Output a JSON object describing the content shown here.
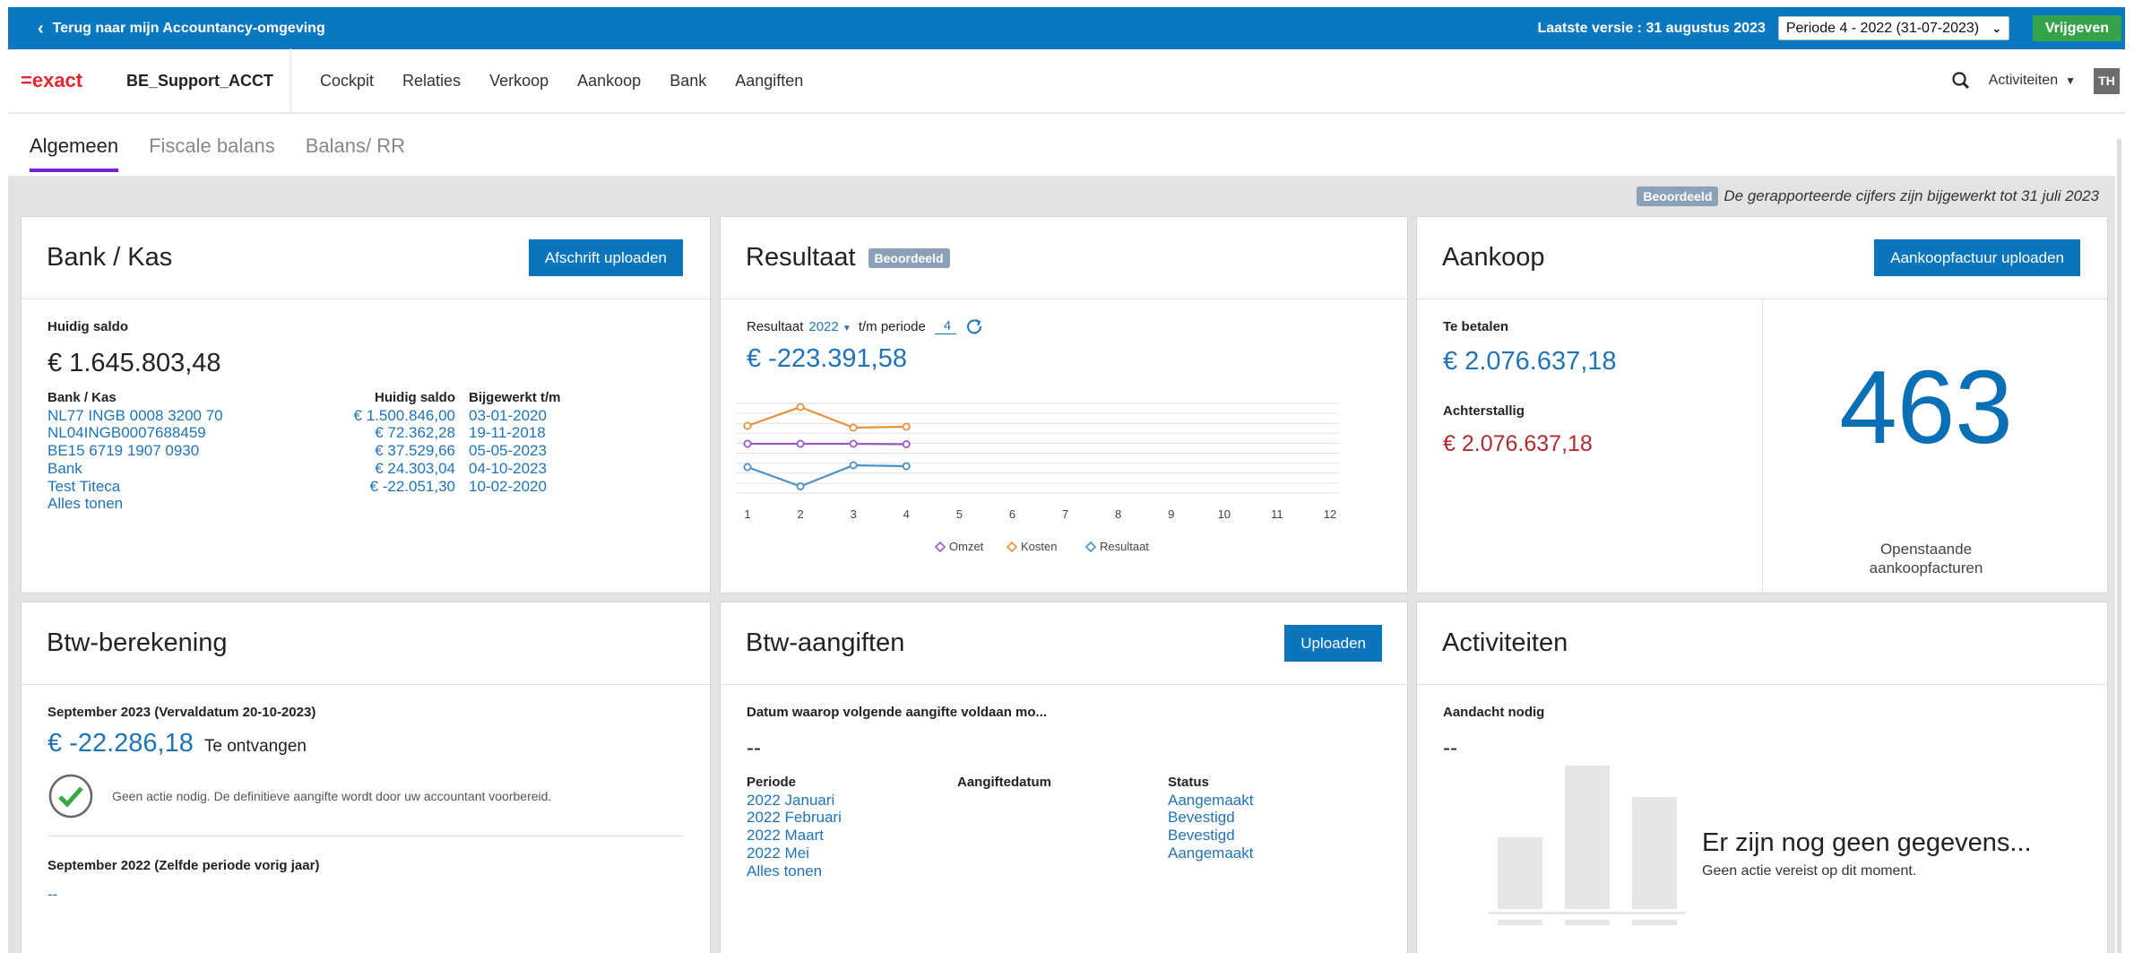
{
  "topbar": {
    "back_label": "Terug naar mijn Accountancy-omgeving",
    "last_version": "Laatste versie : 31 augustus 2023",
    "period": "Periode 4 - 2022 (31-07-2023)",
    "release_label": "Vrijgeven"
  },
  "nav": {
    "logo": "=exact",
    "company": "BE_Support_ACCT",
    "items": [
      "Cockpit",
      "Relaties",
      "Verkoop",
      "Aankoop",
      "Bank",
      "Aangiften"
    ],
    "activities_label": "Activiteiten",
    "avatar": "TH",
    "search_icon": "search-icon"
  },
  "tabs": [
    "Algemeen",
    "Fiscale balans",
    "Balans/ RR"
  ],
  "notice": {
    "badge": "Beoordeeld",
    "text": "De gerapporteerde cijfers zijn bijgewerkt tot 31 juli 2023"
  },
  "bank": {
    "title": "Bank / Kas",
    "button": "Afschrift uploaden",
    "saldo_label": "Huidig saldo",
    "saldo": "€ 1.645.803,48",
    "col_account": "Bank / Kas",
    "col_saldo": "Huidig saldo",
    "col_updated": "Bijgewerkt t/m",
    "rows": [
      {
        "account": "NL77 INGB 0008 3200 70",
        "saldo": "€ 1.500.846,00",
        "date": "03-01-2020"
      },
      {
        "account": "NL04INGB0007688459",
        "saldo": "€ 72.362,28",
        "date": "19-11-2018"
      },
      {
        "account": "BE15 6719 1907 0930",
        "saldo": "€ 37.529,66",
        "date": "05-05-2023"
      },
      {
        "account": "Bank",
        "saldo": "€ 24.303,04",
        "date": "04-10-2023"
      },
      {
        "account": "Test Titeca",
        "saldo": "€ -22.051,30",
        "date": "10-02-2020"
      }
    ],
    "show_all": "Alles tonen"
  },
  "resultaat": {
    "title": "Resultaat",
    "badge": "Beoordeeld",
    "filter_label": "Resultaat",
    "year": "2022",
    "upto_label": "t/m periode",
    "period": "4",
    "amount": "€ -223.391,58"
  },
  "chart_data": {
    "type": "line",
    "x": [
      1,
      2,
      3,
      4,
      5,
      6,
      7,
      8,
      9,
      10,
      11,
      12
    ],
    "x_tick_labels": [
      "1",
      "2",
      "3",
      "4",
      "5",
      "6",
      "7",
      "8",
      "9",
      "10",
      "11",
      "12"
    ],
    "ylim": [
      -100,
      100
    ],
    "grid": true,
    "legend_position": "bottom",
    "series": [
      {
        "name": "Omzet",
        "color": "#9b59c9",
        "values": [
          10,
          10,
          10,
          9
        ]
      },
      {
        "name": "Kosten",
        "color": "#e8913a",
        "values": [
          50,
          92,
          46,
          48
        ]
      },
      {
        "name": "Resultaat",
        "color": "#4a90c8",
        "values": [
          -42,
          -85,
          -38,
          -40
        ]
      }
    ]
  },
  "aankoop": {
    "title": "Aankoop",
    "button": "Aankoopfactuur uploaden",
    "pay_label": "Te betalen",
    "pay_amount": "€ 2.076.637,18",
    "overdue_label": "Achterstallig",
    "overdue_amount": "€ 2.076.637,18",
    "open_count": "463",
    "open_label_1": "Openstaande",
    "open_label_2": "aankoopfacturen"
  },
  "btw": {
    "title": "Btw-berekening",
    "period_label": "September 2023 (Vervaldatum 20-10-2023)",
    "amount": "€ -22.286,18",
    "amount_suffix": "Te ontvangen",
    "status_text": "Geen actie nodig. De definitieve aangifte wordt door uw accountant voorbereid.",
    "prev_label": "September 2022 (Zelfde periode vorig jaar)",
    "prev_value": "--"
  },
  "aangiften": {
    "title": "Btw-aangiften",
    "button": "Uploaden",
    "next_label": "Datum waarop volgende aangifte voldaan mo...",
    "next_value": "--",
    "col_period": "Periode",
    "col_date": "Aangiftedatum",
    "col_status": "Status",
    "rows": [
      {
        "period": "2022 Januari",
        "status": "Aangemaakt"
      },
      {
        "period": "2022 Februari",
        "status": "Bevestigd"
      },
      {
        "period": "2022 Maart",
        "status": "Bevestigd"
      },
      {
        "period": "2022 Mei",
        "status": "Aangemaakt"
      }
    ],
    "show_all": "Alles tonen"
  },
  "activiteiten": {
    "title": "Activiteiten",
    "attention_label": "Aandacht nodig",
    "attention_value": "--",
    "empty_title": "Er zijn nog geen gegevens...",
    "empty_sub": "Geen actie vereist op dit moment."
  }
}
